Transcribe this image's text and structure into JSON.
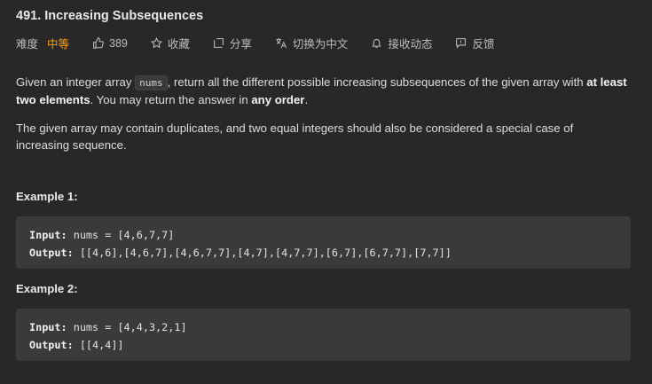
{
  "problem": {
    "title": "491. Increasing Subsequences"
  },
  "meta": {
    "difficulty_label": "难度",
    "difficulty": "中等",
    "likes": "389",
    "favorite_label": "收藏",
    "share_label": "分享",
    "translate_label": "切换为中文",
    "subscribe_label": "接收动态",
    "feedback_label": "反馈"
  },
  "description": {
    "p1_a": "Given an integer array ",
    "p1_code": "nums",
    "p1_b": ", return all the different possible increasing subsequences of the given array with ",
    "p1_bold1": "at least two elements",
    "p1_c": ". You may return the answer in ",
    "p1_bold2": "any order",
    "p1_d": ".",
    "p2": "The given array may contain duplicates, and two equal integers should also be considered a special case of increasing sequence."
  },
  "examples": [
    {
      "title": "Example 1:",
      "input_label": "Input:",
      "input_value": " nums = [4,6,7,7]",
      "output_label": "Output:",
      "output_value": " [[4,6],[4,6,7],[4,6,7,7],[4,7],[4,7,7],[6,7],[6,7,7],[7,7]]"
    },
    {
      "title": "Example 2:",
      "input_label": "Input:",
      "input_value": " nums = [4,4,3,2,1]",
      "output_label": "Output:",
      "output_value": " [[4,4]]"
    }
  ],
  "colors": {
    "background": "#282828",
    "difficulty_medium": "#ffa116",
    "code_block": "#3a3a3a"
  }
}
